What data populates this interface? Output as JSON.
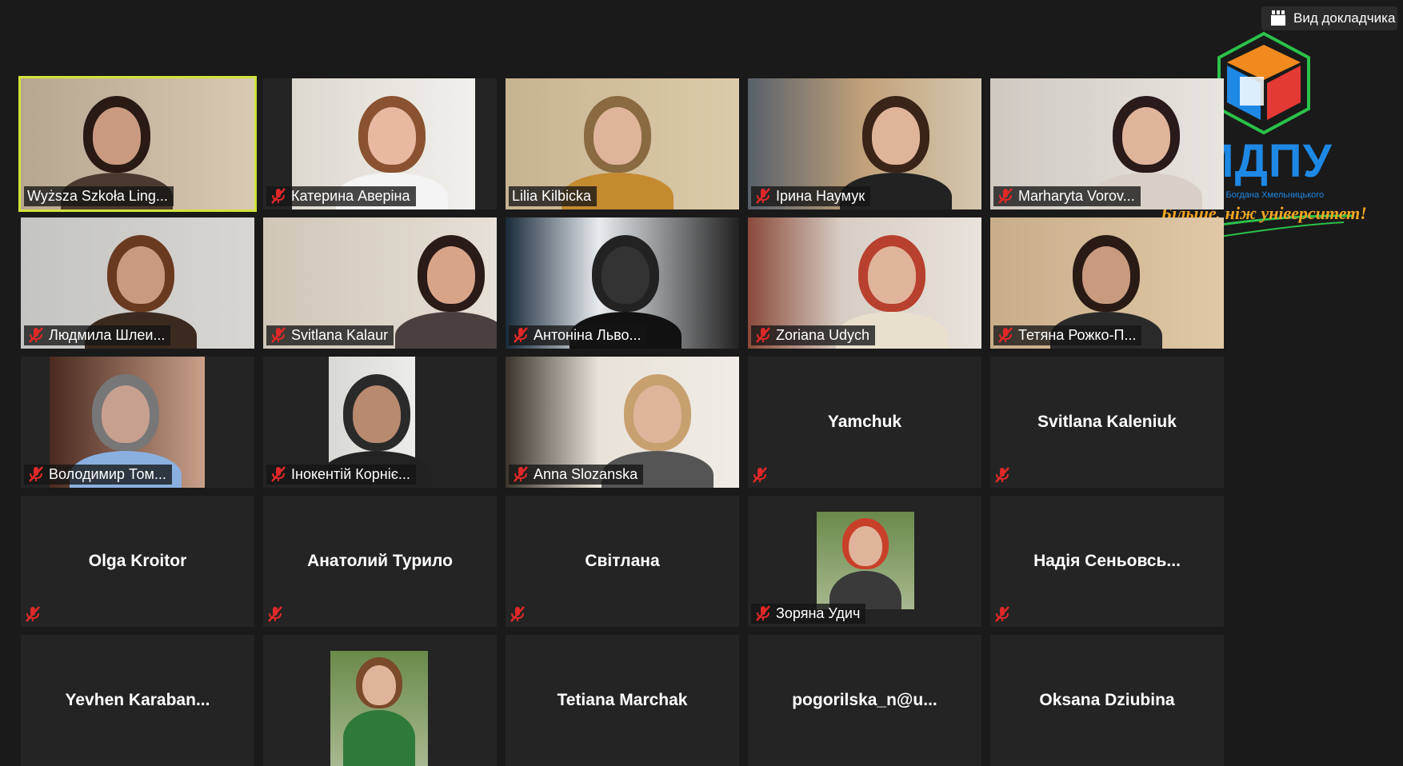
{
  "toolbar": {
    "view_button_label": "Вид докладчика"
  },
  "logo": {
    "title": "МДПУ",
    "subtitle": "імені Богдана Хмельницького",
    "slogan": "Більше, ніж університет!"
  },
  "participants": [
    {
      "name": "Wyższa Szkoła Ling...",
      "muted": false,
      "video": true,
      "active": true
    },
    {
      "name": "Катерина Аверіна",
      "muted": true,
      "video": true
    },
    {
      "name": "Lilia Kilbicka",
      "muted": false,
      "video": true
    },
    {
      "name": "Ірина Наумук",
      "muted": true,
      "video": true
    },
    {
      "name": "Marharyta Vorov...",
      "muted": true,
      "video": true
    },
    {
      "name": "Людмила Шлеи...",
      "muted": true,
      "video": true
    },
    {
      "name": "Svitlana Kalaur",
      "muted": true,
      "video": true
    },
    {
      "name": "Антоніна Льво...",
      "muted": true,
      "video": true
    },
    {
      "name": "Zoriana Udych",
      "muted": true,
      "video": true
    },
    {
      "name": "Тетяна Рожко-П...",
      "muted": true,
      "video": true
    },
    {
      "name": "Володимир Том...",
      "muted": true,
      "video": true
    },
    {
      "name": "Інокентій Корніє...",
      "muted": true,
      "video": true
    },
    {
      "name": "Anna Slozanska",
      "muted": true,
      "video": true
    },
    {
      "name": "Yamchuk",
      "muted": true,
      "video": false
    },
    {
      "name": "Svitlana Kaleniuk",
      "muted": true,
      "video": false
    },
    {
      "name": "Olga Kroitor",
      "muted": true,
      "video": false
    },
    {
      "name": "Анатолий Турило",
      "muted": true,
      "video": false
    },
    {
      "name": "Світлана",
      "muted": true,
      "video": false
    },
    {
      "name": "Зоряна Удич",
      "muted": true,
      "video": false,
      "avatar": true
    },
    {
      "name": "Надія Сеньовсь...",
      "muted": true,
      "video": false
    },
    {
      "name": "Yevhen Karaban...",
      "muted": false,
      "video": false
    },
    {
      "name": "",
      "muted": false,
      "video": false,
      "avatar": true
    },
    {
      "name": "Tetiana Marchak",
      "muted": false,
      "video": false
    },
    {
      "name": "pogorilska_n@u...",
      "muted": false,
      "video": false
    },
    {
      "name": "Oksana Dziubina",
      "muted": false,
      "video": false
    }
  ]
}
